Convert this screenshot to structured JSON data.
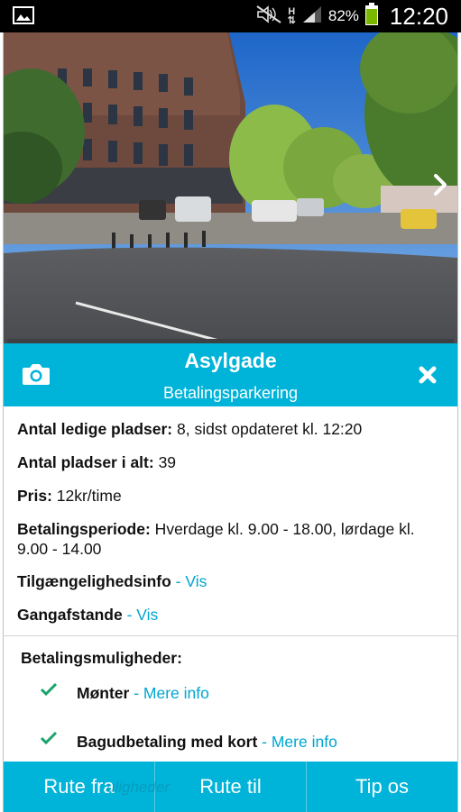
{
  "status_bar": {
    "network": "H",
    "battery_percent": "82%",
    "time": "12:20"
  },
  "header": {
    "title": "Asylgade",
    "subtitle": "Betalingsparkering"
  },
  "details": {
    "available_label": "Antal ledige pladser:",
    "available_value": " 8, sidst opdateret kl. 12:20",
    "total_label": "Antal pladser i alt:",
    "total_value": " 39",
    "price_label": "Pris:",
    "price_value": " 12kr/time",
    "period_label": "Betalingsperiode:",
    "period_value": " Hverdage kl. 9.00 - 18.00, lørdage kl. 9.00 - 14.00",
    "accessibility_label": "Tilgængelighedsinfo",
    "accessibility_link": " - Vis",
    "walking_label": "Gangafstande",
    "walking_link": " - Vis"
  },
  "payment": {
    "title": "Betalingsmuligheder:",
    "items": [
      {
        "label": "Mønter",
        "link": " - Mere info"
      },
      {
        "label": "Bagudbetaling med kort",
        "link": " - Mere info"
      }
    ],
    "partial_text": "uligheder"
  },
  "bottom_bar": {
    "route_from": "Rute fra",
    "route_to": "Rute til",
    "tip": "Tip os"
  },
  "colors": {
    "accent": "#00b3d8",
    "link": "#00a6cf",
    "check": "#1aa36b",
    "battery": "#7ab800"
  }
}
